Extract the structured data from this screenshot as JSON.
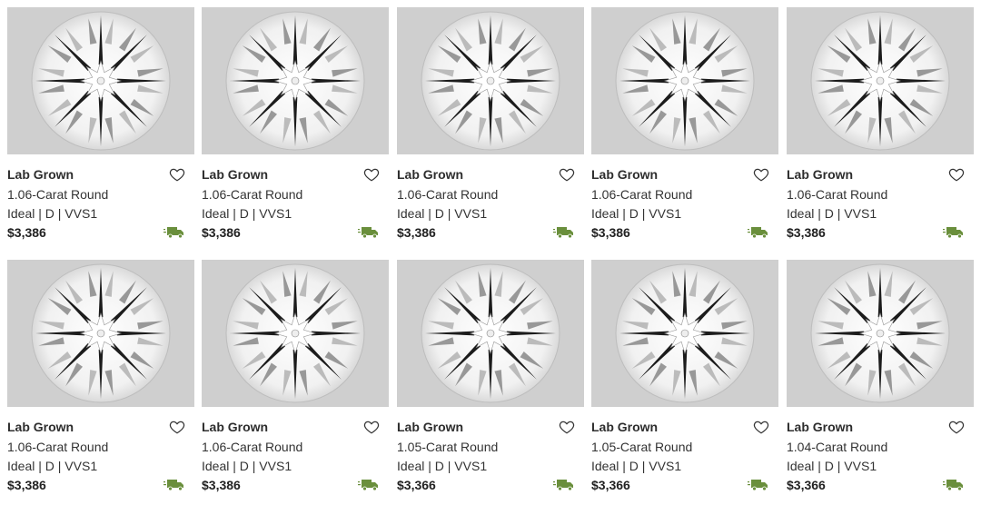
{
  "colors": {
    "truck": "#6a8f3c",
    "tile_bg": "#cfcfcf",
    "heart_stroke": "#333333"
  },
  "products": [
    {
      "type": "Lab Grown",
      "title": "1.06-Carat Round",
      "specs": "Ideal | D | VVS1",
      "price": "$3,386",
      "icon_fav": "heart-outline-icon",
      "icon_ship": "truck-icon"
    },
    {
      "type": "Lab Grown",
      "title": "1.06-Carat Round",
      "specs": "Ideal | D | VVS1",
      "price": "$3,386",
      "icon_fav": "heart-outline-icon",
      "icon_ship": "truck-icon"
    },
    {
      "type": "Lab Grown",
      "title": "1.06-Carat Round",
      "specs": "Ideal | D | VVS1",
      "price": "$3,386",
      "icon_fav": "heart-outline-icon",
      "icon_ship": "truck-icon"
    },
    {
      "type": "Lab Grown",
      "title": "1.06-Carat Round",
      "specs": "Ideal | D | VVS1",
      "price": "$3,386",
      "icon_fav": "heart-outline-icon",
      "icon_ship": "truck-icon"
    },
    {
      "type": "Lab Grown",
      "title": "1.06-Carat Round",
      "specs": "Ideal | D | VVS1",
      "price": "$3,386",
      "icon_fav": "heart-outline-icon",
      "icon_ship": "truck-icon"
    },
    {
      "type": "Lab Grown",
      "title": "1.06-Carat Round",
      "specs": "Ideal | D | VVS1",
      "price": "$3,386",
      "icon_fav": "heart-outline-icon",
      "icon_ship": "truck-icon"
    },
    {
      "type": "Lab Grown",
      "title": "1.06-Carat Round",
      "specs": "Ideal | D | VVS1",
      "price": "$3,386",
      "icon_fav": "heart-outline-icon",
      "icon_ship": "truck-icon"
    },
    {
      "type": "Lab Grown",
      "title": "1.05-Carat Round",
      "specs": "Ideal | D | VVS1",
      "price": "$3,366",
      "icon_fav": "heart-outline-icon",
      "icon_ship": "truck-icon"
    },
    {
      "type": "Lab Grown",
      "title": "1.05-Carat Round",
      "specs": "Ideal | D | VVS1",
      "price": "$3,366",
      "icon_fav": "heart-outline-icon",
      "icon_ship": "truck-icon"
    },
    {
      "type": "Lab Grown",
      "title": "1.04-Carat Round",
      "specs": "Ideal | D | VVS1",
      "price": "$3,366",
      "icon_fav": "heart-outline-icon",
      "icon_ship": "truck-icon"
    }
  ]
}
